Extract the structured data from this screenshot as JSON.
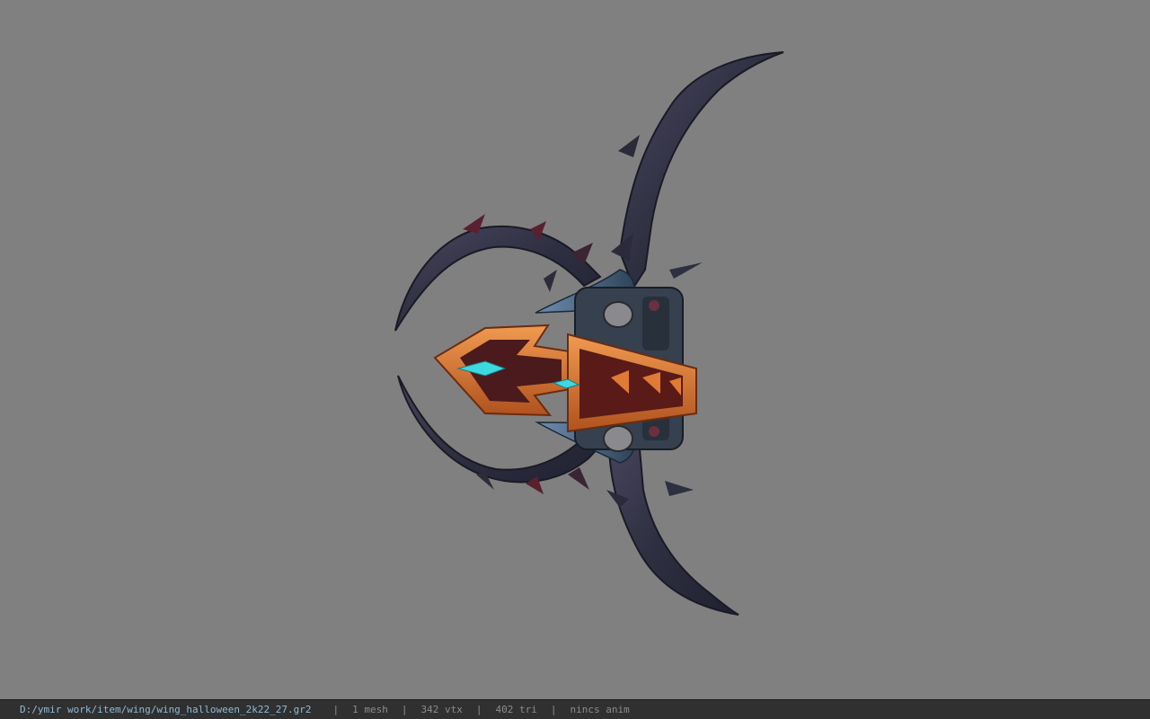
{
  "viewport": {
    "background_color": "#808080",
    "model": "wing_halloween_2k22_27",
    "model_colors": {
      "horn_dark": "#2c2c3c",
      "horn_mid": "#3a3e52",
      "steel_blue": "#4a6a88",
      "orange_trim": "#e07a34",
      "dark_red": "#5a1a18",
      "cyan_gem": "#3ed8e0"
    }
  },
  "status_bar": {
    "path": "D:/ymir work/item/wing/wing_halloween_2k22_27.gr2",
    "separator": "|",
    "meshes": "1 mesh",
    "vertices": "342 vtx",
    "triangles": "402 tri",
    "animation": "nincs anim"
  }
}
